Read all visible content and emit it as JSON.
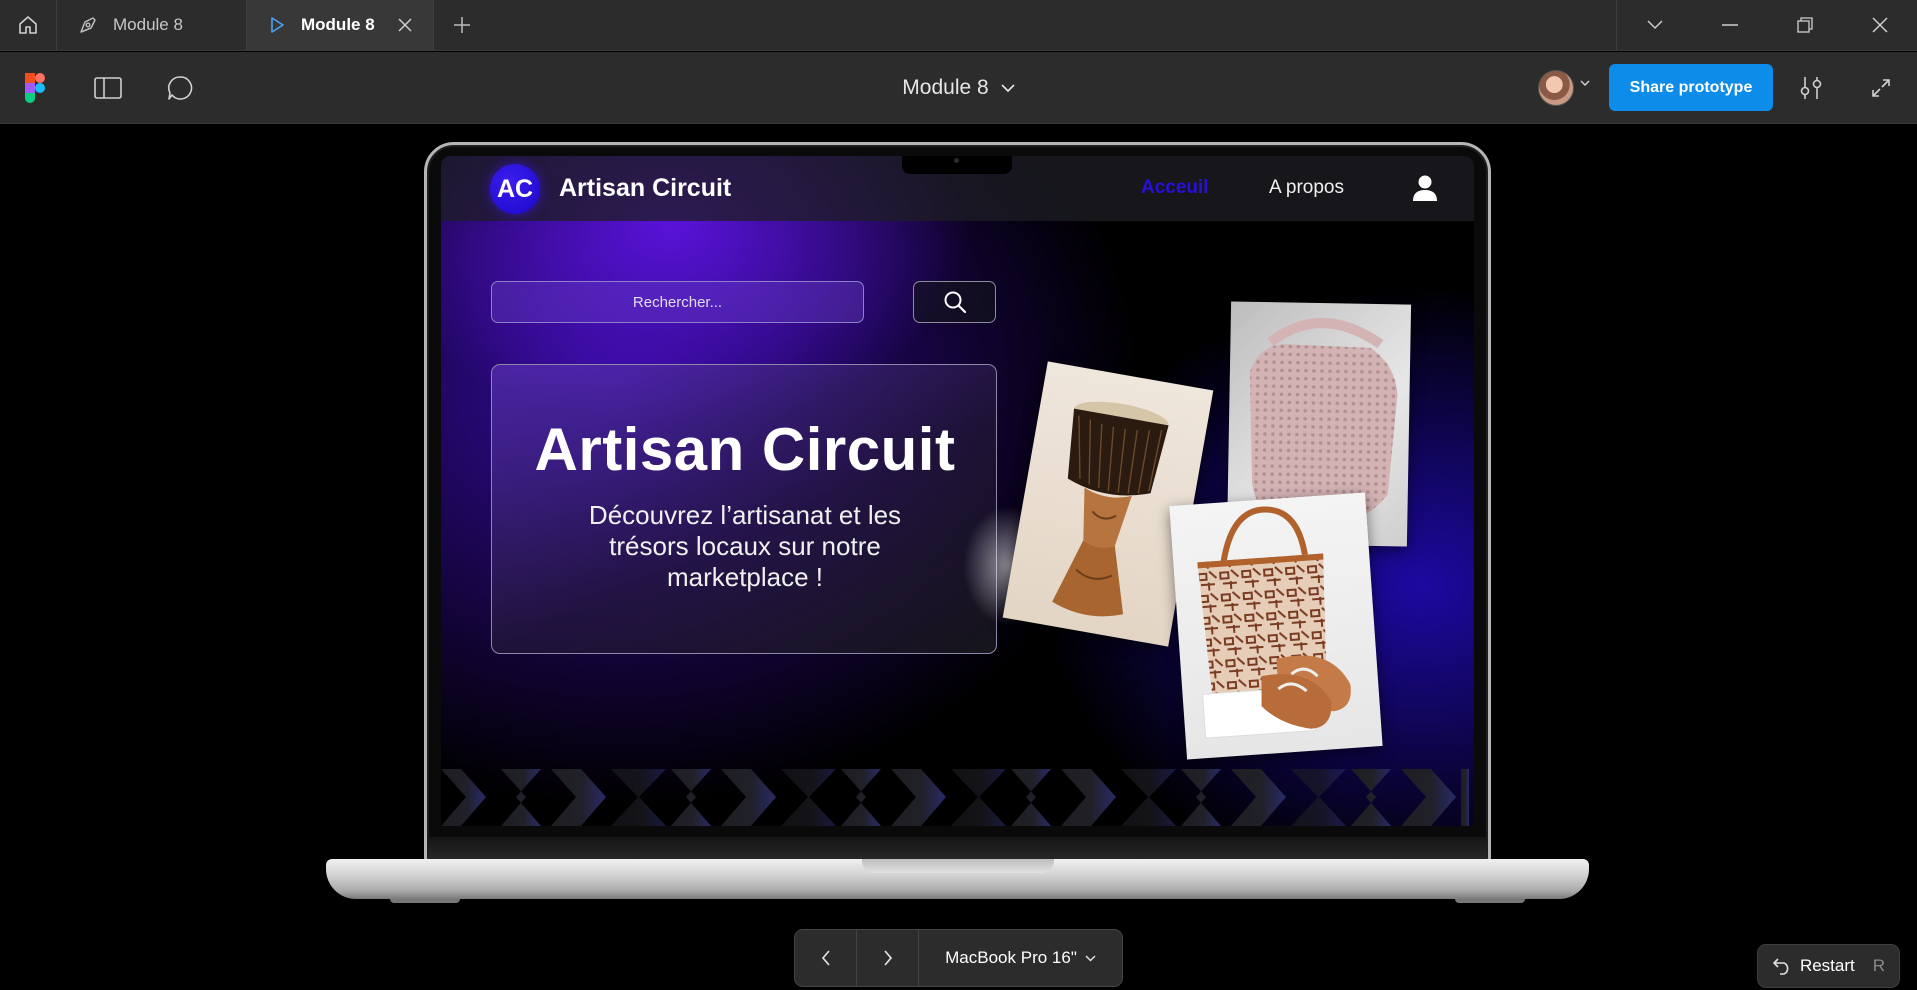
{
  "titlebar": {
    "tabs": [
      {
        "label": "Module 8",
        "icon": "design-file-icon",
        "active": false
      },
      {
        "label": "Module 8",
        "icon": "play-icon",
        "active": true
      }
    ]
  },
  "toolbar": {
    "document_title": "Module 8",
    "share_label": "Share prototype"
  },
  "site": {
    "logo_initials": "AC",
    "brand_name": "Artisan Circuit",
    "nav": {
      "home": "Acceuil",
      "about": "A propos"
    },
    "search_placeholder": "Rechercher...",
    "hero_title": "Artisan Circuit",
    "hero_subtitle": "Découvrez l’artisanat et les trésors locaux sur notre marketplace !",
    "accent_color": "#2710d8"
  },
  "prototype_controls": {
    "device": "MacBook Pro 16\"",
    "restart_label": "Restart",
    "restart_shortcut": "R"
  },
  "colors": {
    "share_button": "#0d8ce9",
    "chrome_bg": "#2c2c2c"
  }
}
